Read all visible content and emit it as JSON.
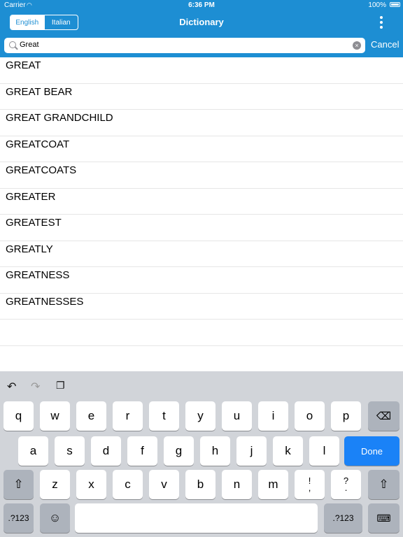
{
  "status": {
    "carrier": "Carrier",
    "time": "6:36 PM",
    "battery": "100%"
  },
  "nav": {
    "title": "Dictionary",
    "segments": [
      "English",
      "Italian"
    ]
  },
  "search": {
    "value": "Great",
    "cancel": "Cancel"
  },
  "results": [
    "GREAT",
    "GREAT BEAR",
    "GREAT GRANDCHILD",
    "GREATCOAT",
    "GREATCOATS",
    "GREATER",
    "GREATEST",
    "GREATLY",
    "GREATNESS",
    "GREATNESSES",
    "",
    ""
  ],
  "keyboard": {
    "row1": [
      "q",
      "w",
      "e",
      "r",
      "t",
      "y",
      "u",
      "i",
      "o",
      "p"
    ],
    "row2": [
      "a",
      "s",
      "d",
      "f",
      "g",
      "h",
      "j",
      "k",
      "l"
    ],
    "row3": [
      "z",
      "x",
      "c",
      "v",
      "b",
      "n",
      "m"
    ],
    "punct1": [
      "!",
      ","
    ],
    "punct2": [
      "?",
      "."
    ],
    "numbers": ".?123",
    "done": "Done"
  }
}
